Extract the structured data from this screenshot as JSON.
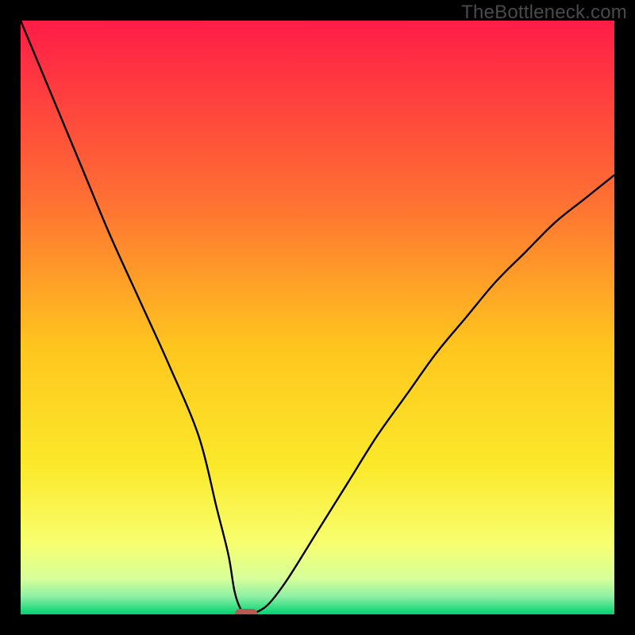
{
  "watermark": "TheBottleneck.com",
  "chart_data": {
    "type": "line",
    "title": "",
    "xlabel": "",
    "ylabel": "",
    "xlim": [
      0,
      100
    ],
    "ylim": [
      0,
      100
    ],
    "x": [
      0,
      5,
      10,
      15,
      20,
      25,
      30,
      33,
      35,
      36,
      37,
      38,
      40,
      42,
      45,
      50,
      55,
      60,
      65,
      70,
      75,
      80,
      85,
      90,
      95,
      100
    ],
    "values": [
      100,
      88,
      76,
      64,
      53,
      42,
      30,
      18,
      10,
      4,
      1,
      0,
      0.5,
      2,
      6,
      14,
      22,
      30,
      37,
      44,
      50,
      56,
      61,
      66,
      70,
      74
    ],
    "annotations": [
      {
        "type": "marker",
        "x": 38,
        "y": 0,
        "color": "#b75a53"
      }
    ],
    "background": {
      "type": "vertical-gradient",
      "stops": [
        {
          "offset": 0.0,
          "color": "#ff1c47"
        },
        {
          "offset": 0.3,
          "color": "#ff6f33"
        },
        {
          "offset": 0.55,
          "color": "#ffc61e"
        },
        {
          "offset": 0.75,
          "color": "#fbe92a"
        },
        {
          "offset": 0.88,
          "color": "#f8ff6f"
        },
        {
          "offset": 0.94,
          "color": "#d6ff9a"
        },
        {
          "offset": 0.97,
          "color": "#8ef0a4"
        },
        {
          "offset": 1.0,
          "color": "#00d271"
        }
      ]
    }
  }
}
